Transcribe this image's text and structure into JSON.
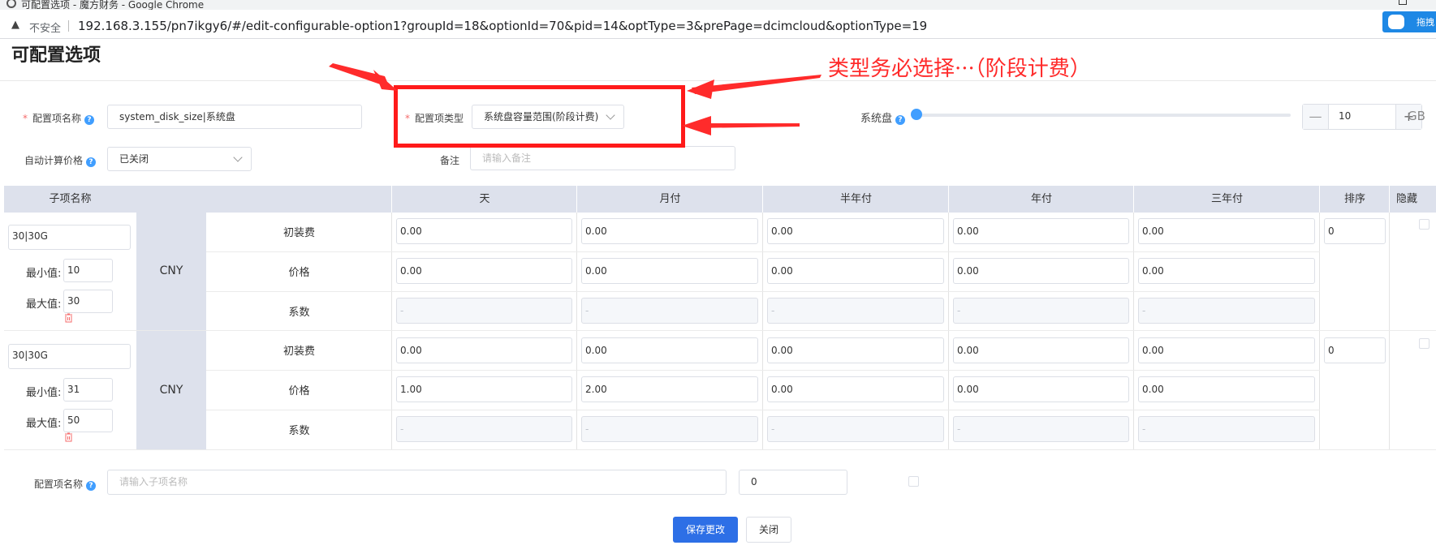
{
  "browser": {
    "title": "可配置选项 - 魔方财务 - Google Chrome",
    "insecure_label": "不安全",
    "url": "192.168.3.155/pn7ikgy6/#/edit-configurable-option1?groupId=18&optionId=70&pid=14&optType=3&prePage=dcimcloud&optionType=19",
    "extension_label": "拖拽"
  },
  "page": {
    "title": "可配置选项"
  },
  "annotation": {
    "text": "类型务必选择···（阶段计费）",
    "color": "#ff2b2b"
  },
  "form": {
    "option_name_label": "配置项名称",
    "option_name_value": "system_disk_size|系统盘",
    "option_type_label": "配置项类型",
    "option_type_value": "系统盘容量范围(阶段计费)",
    "auto_price_label": "自动计算价格",
    "auto_price_value": "已关闭",
    "remark_label": "备注",
    "remark_placeholder": "请输入备注",
    "disk_label": "系统盘",
    "disk_value": "10",
    "disk_unit": "GB",
    "stepper_minus": "—",
    "stepper_plus": "+"
  },
  "table": {
    "headers": {
      "sub_name": "子项名称",
      "day": "天",
      "month": "月付",
      "half_year": "半年付",
      "year": "年付",
      "three_year": "三年付",
      "sort": "排序",
      "hidden": "隐藏"
    },
    "row_labels": {
      "setup": "初装费",
      "price": "价格",
      "coef": "系数"
    },
    "currency": "CNY",
    "min_label": "最小值:",
    "max_label": "最大值:",
    "disabled_placeholder": "-",
    "rows": [
      {
        "name": "30|30G",
        "min": "10",
        "max": "30",
        "sort": "0",
        "setup": [
          "0.00",
          "0.00",
          "0.00",
          "0.00",
          "0.00"
        ],
        "price": [
          "0.00",
          "0.00",
          "0.00",
          "0.00",
          "0.00"
        ]
      },
      {
        "name": "30|30G",
        "min": "31",
        "max": "50",
        "sort": "0",
        "setup": [
          "0.00",
          "0.00",
          "0.00",
          "0.00",
          "0.00"
        ],
        "price": [
          "1.00",
          "2.00",
          "0.00",
          "0.00",
          "0.00"
        ]
      }
    ]
  },
  "new_item": {
    "label": "配置项名称",
    "placeholder": "请输入子项名称",
    "sort_value": "0"
  },
  "buttons": {
    "save": "保存更改",
    "close": "关闭"
  }
}
